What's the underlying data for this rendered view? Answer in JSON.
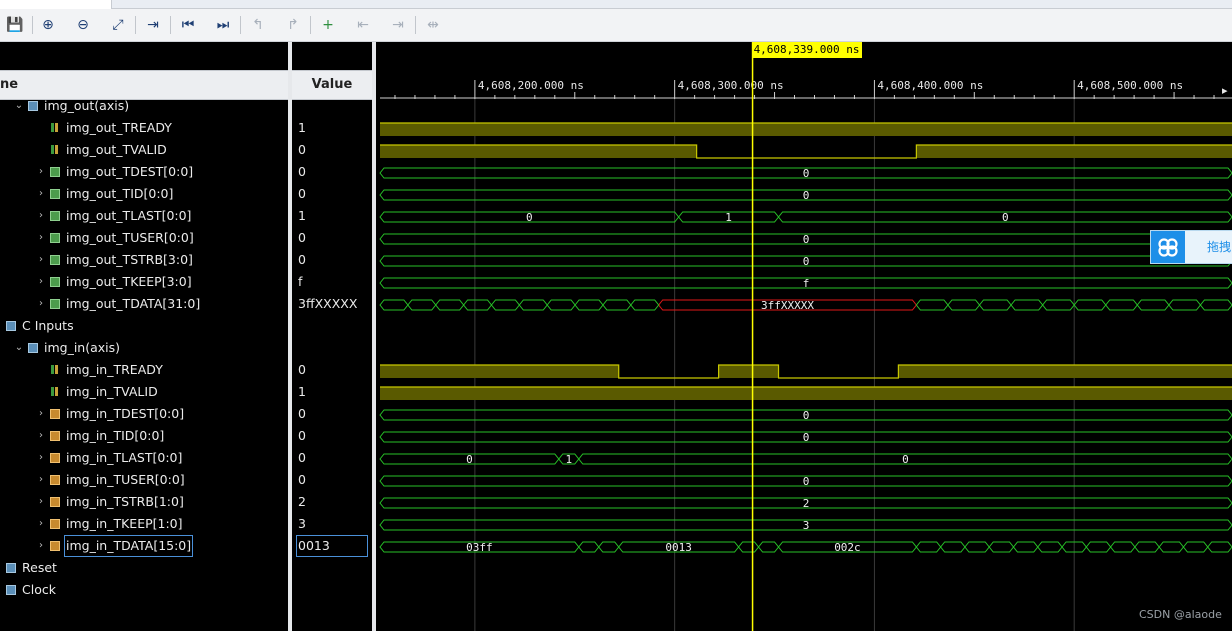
{
  "toolbar": {
    "buttons": [
      {
        "icon": "save-icon",
        "glyph": "💾"
      },
      {
        "icon": "zoom-in-icon",
        "glyph": "⊕"
      },
      {
        "icon": "zoom-out-icon",
        "glyph": "⊖"
      },
      {
        "icon": "zoom-fit-icon",
        "glyph": "⤢"
      },
      {
        "icon": "go-to-cursor-icon",
        "glyph": "⇥"
      },
      {
        "icon": "go-to-time-0-icon",
        "glyph": "⏮"
      },
      {
        "icon": "go-to-last-time-icon",
        "glyph": "⏭"
      },
      {
        "icon": "previous-transition-icon",
        "glyph": "↰"
      },
      {
        "icon": "next-transition-icon",
        "glyph": "↱"
      },
      {
        "icon": "add-marker-icon",
        "glyph": "+"
      },
      {
        "icon": "previous-marker-icon",
        "glyph": "⇤"
      },
      {
        "icon": "next-marker-icon",
        "glyph": "⇥"
      },
      {
        "icon": "swap-cursors-icon",
        "glyph": "⇹"
      }
    ]
  },
  "headers": {
    "name": "ne",
    "value": "Value"
  },
  "signals": [
    {
      "name": "img_out(axis)",
      "value": "",
      "kind": "group",
      "level": 1,
      "expand": "v",
      "clip": true
    },
    {
      "name": "img_out_TREADY",
      "value": "1",
      "kind": "bit",
      "level": 2,
      "expand": ""
    },
    {
      "name": "img_out_TVALID",
      "value": "0",
      "kind": "bit",
      "level": 2,
      "expand": ""
    },
    {
      "name": "img_out_TDEST[0:0]",
      "value": "0",
      "kind": "bus-g",
      "level": 2,
      "expand": ">"
    },
    {
      "name": "img_out_TID[0:0]",
      "value": "0",
      "kind": "bus-g",
      "level": 2,
      "expand": ">"
    },
    {
      "name": "img_out_TLAST[0:0]",
      "value": "1",
      "kind": "bus-g",
      "level": 2,
      "expand": ">"
    },
    {
      "name": "img_out_TUSER[0:0]",
      "value": "0",
      "kind": "bus-g",
      "level": 2,
      "expand": ">"
    },
    {
      "name": "img_out_TSTRB[3:0]",
      "value": "0",
      "kind": "bus-g",
      "level": 2,
      "expand": ">"
    },
    {
      "name": "img_out_TKEEP[3:0]",
      "value": "f",
      "kind": "bus-g",
      "level": 2,
      "expand": ">"
    },
    {
      "name": "img_out_TDATA[31:0]",
      "value": "3ffXXXXX",
      "kind": "bus-g",
      "level": 2,
      "expand": ">"
    },
    {
      "name": "C Inputs",
      "value": "",
      "kind": "group",
      "level": 0,
      "expand": ""
    },
    {
      "name": "img_in(axis)",
      "value": "",
      "kind": "group",
      "level": 1,
      "expand": "v"
    },
    {
      "name": "img_in_TREADY",
      "value": "0",
      "kind": "bit",
      "level": 2,
      "expand": ""
    },
    {
      "name": "img_in_TVALID",
      "value": "1",
      "kind": "bit",
      "level": 2,
      "expand": ""
    },
    {
      "name": "img_in_TDEST[0:0]",
      "value": "0",
      "kind": "bus-o",
      "level": 2,
      "expand": ">"
    },
    {
      "name": "img_in_TID[0:0]",
      "value": "0",
      "kind": "bus-o",
      "level": 2,
      "expand": ">"
    },
    {
      "name": "img_in_TLAST[0:0]",
      "value": "0",
      "kind": "bus-o",
      "level": 2,
      "expand": ">"
    },
    {
      "name": "img_in_TUSER[0:0]",
      "value": "0",
      "kind": "bus-o",
      "level": 2,
      "expand": ">"
    },
    {
      "name": "img_in_TSTRB[1:0]",
      "value": "2",
      "kind": "bus-o",
      "level": 2,
      "expand": ">"
    },
    {
      "name": "img_in_TKEEP[1:0]",
      "value": "3",
      "kind": "bus-o",
      "level": 2,
      "expand": ">"
    },
    {
      "name": "img_in_TDATA[15:0]",
      "value": "0013",
      "kind": "bus-o",
      "level": 2,
      "expand": ">",
      "selected": true
    },
    {
      "name": "Reset",
      "value": "",
      "kind": "group",
      "level": 0,
      "expand": ""
    },
    {
      "name": "Clock",
      "value": "",
      "kind": "group",
      "level": 0,
      "expand": ""
    }
  ],
  "timeline": {
    "unit": "ns",
    "view_start_ns": 4608152.5,
    "view_end_ns": 4608579.0,
    "cursor_ns": 4608339.0,
    "cursor_label": "4,608,339.000 ns",
    "ticks": [
      {
        "t": 4608200,
        "label": "4,608,200.000 ns"
      },
      {
        "t": 4608300,
        "label": "4,608,300.000 ns"
      },
      {
        "t": 4608400,
        "label": "4,608,400.000 ns"
      },
      {
        "t": 4608500,
        "label": "4,608,500.000 ns"
      }
    ]
  },
  "waves": [
    null,
    {
      "type": "bit",
      "edges": [
        [
          4608152.5,
          1
        ]
      ]
    },
    {
      "type": "bit",
      "edges": [
        [
          4608152.5,
          1
        ],
        [
          4608311,
          0
        ],
        [
          4608421,
          1
        ]
      ]
    },
    {
      "type": "bus",
      "segs": [
        {
          "v": "0"
        }
      ]
    },
    {
      "type": "bus",
      "segs": [
        {
          "v": "0"
        }
      ]
    },
    {
      "type": "bus",
      "segs": [
        {
          "from": 4608152.5,
          "to": 4608302,
          "v": "0"
        },
        {
          "from": 4608302,
          "to": 4608352,
          "v": "1"
        },
        {
          "from": 4608352,
          "to": 4608579,
          "v": "0"
        }
      ]
    },
    {
      "type": "bus",
      "segs": [
        {
          "v": "0"
        }
      ]
    },
    {
      "type": "bus",
      "segs": [
        {
          "v": "0"
        }
      ]
    },
    {
      "type": "bus",
      "segs": [
        {
          "v": "f"
        }
      ]
    },
    {
      "type": "bus-dense",
      "dense": [
        [
          4608152.5,
          4608292,
          10
        ],
        [
          4608421,
          4608579,
          10
        ]
      ],
      "segs": [
        {
          "from": 4608292,
          "to": 4608421,
          "v": "3ffXXXXX",
          "color": "red"
        }
      ]
    },
    null,
    null,
    {
      "type": "bit",
      "edges": [
        [
          4608152.5,
          1
        ],
        [
          4608272,
          0
        ],
        [
          4608322,
          1
        ],
        [
          4608352,
          0
        ],
        [
          4608412,
          1
        ]
      ]
    },
    {
      "type": "bit",
      "edges": [
        [
          4608152.5,
          1
        ]
      ]
    },
    {
      "type": "bus",
      "segs": [
        {
          "v": "0"
        }
      ]
    },
    {
      "type": "bus",
      "segs": [
        {
          "v": "0"
        }
      ]
    },
    {
      "type": "bus",
      "segs": [
        {
          "from": 4608152.5,
          "to": 4608242,
          "v": "0"
        },
        {
          "from": 4608242,
          "to": 4608252,
          "v": "1"
        },
        {
          "from": 4608252,
          "to": 4608579,
          "v": "0"
        }
      ]
    },
    {
      "type": "bus",
      "segs": [
        {
          "v": "0"
        }
      ]
    },
    {
      "type": "bus",
      "segs": [
        {
          "v": "2"
        }
      ]
    },
    {
      "type": "bus",
      "segs": [
        {
          "v": "3"
        }
      ]
    },
    {
      "type": "bus-dense",
      "dense": [
        [
          4608252,
          4608272,
          2
        ],
        [
          4608332,
          4608352,
          2
        ],
        [
          4608421,
          4608579,
          13
        ]
      ],
      "segs": [
        {
          "from": 4608152.5,
          "to": 4608252,
          "v": "03ff"
        },
        {
          "from": 4608272,
          "to": 4608332,
          "v": "0013"
        },
        {
          "from": 4608352,
          "to": 4608421,
          "v": "002c"
        }
      ]
    },
    null,
    null
  ],
  "colors": {
    "bit_fill": "#5a5a00",
    "bit_line": "#c8c800",
    "bus": "#27c027",
    "bus_err": "#e01818",
    "cursor": "#ffff00",
    "grid": "#3a3a3a"
  },
  "overlay": {
    "label": "拖拽"
  },
  "watermark": "CSDN @alaode"
}
